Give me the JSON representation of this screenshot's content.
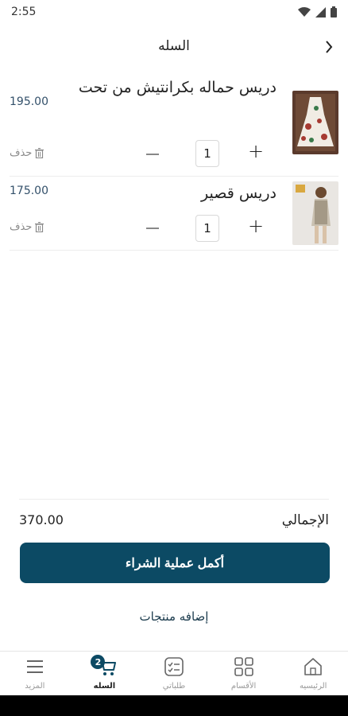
{
  "status_bar": {
    "time": "2:55"
  },
  "header": {
    "title": "السله"
  },
  "cart": {
    "items": [
      {
        "name": "دريس حماله بكرانتيش من تحت",
        "price": "195.00",
        "quantity": "1",
        "delete_label": "حذف"
      },
      {
        "name": "دريس قصير",
        "price": "175.00",
        "quantity": "1",
        "delete_label": "حذف"
      }
    ],
    "total_label": "الإجمالي",
    "total_value": "370.00"
  },
  "actions": {
    "checkout_label": "أكمل عملية الشراء",
    "add_products_label": "إضافه منتجات"
  },
  "bottom_nav": {
    "items": [
      {
        "label": "الرئيسيه",
        "icon": "home-icon"
      },
      {
        "label": "الأقسام",
        "icon": "grid-icon"
      },
      {
        "label": "طلباتي",
        "icon": "orders-icon"
      },
      {
        "label": "السله",
        "icon": "cart-icon",
        "badge": "2",
        "active": true
      },
      {
        "label": "المزيد",
        "icon": "menu-icon"
      }
    ]
  },
  "colors": {
    "primary": "#0c4a64",
    "price": "#33506a"
  }
}
